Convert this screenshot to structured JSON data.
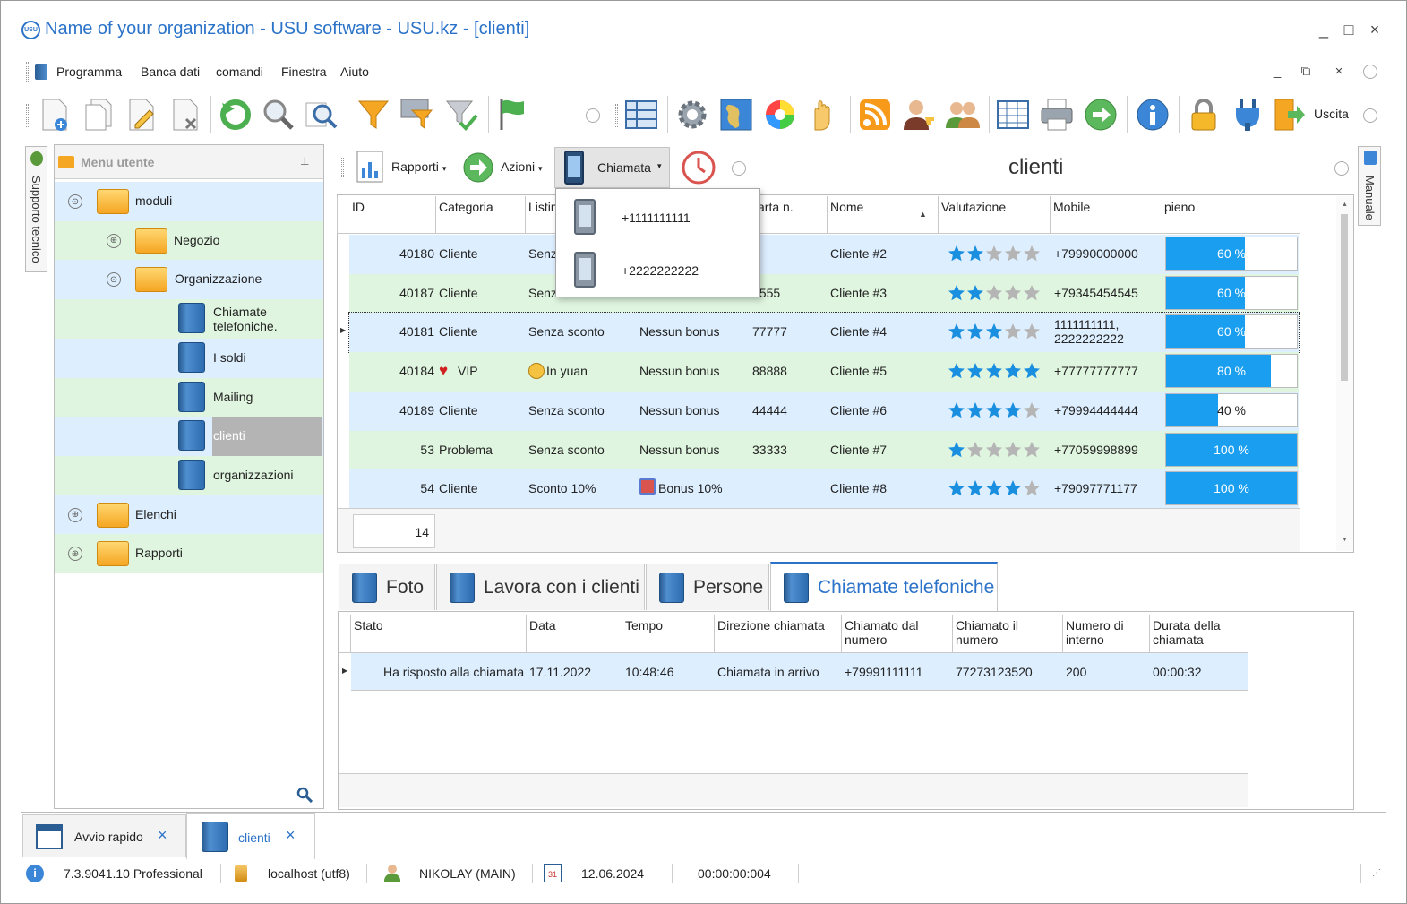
{
  "window": {
    "title": "Name of your organization - USU software - USU.kz - [clienti]",
    "logo_text": "USU",
    "controls": [
      "_",
      "□",
      "×"
    ]
  },
  "menu": {
    "items": [
      "Programma",
      "Banca dati",
      "comandi",
      "Finestra",
      "Aiuto"
    ],
    "mdi_controls": [
      "_",
      "⧉",
      "×"
    ]
  },
  "toolbar": {
    "exit_label": "Uscita"
  },
  "side_tabs": {
    "left": "Supporto tecnico",
    "right": "Manuale"
  },
  "user_menu": {
    "header": "Menu utente",
    "pin": "⊥",
    "items": [
      {
        "label": "moduli",
        "icon": "folder-icon",
        "expander": "⊙",
        "color": "#ddeeff"
      },
      {
        "label": "Negozio",
        "icon": "folder-icon",
        "expander": "⊕",
        "color": "#dff5df"
      },
      {
        "label": "Organizzazione",
        "icon": "folder-icon",
        "expander": "⊙",
        "color": "#ddeeff"
      },
      {
        "label": "Chiamate telefoniche.",
        "icon": "book-icon",
        "color": "#dff5df"
      },
      {
        "label": "I soldi",
        "icon": "book-icon",
        "color": "#ddeeff"
      },
      {
        "label": "Mailing",
        "icon": "book-icon",
        "color": "#dff5df"
      },
      {
        "label": "clienti",
        "icon": "book-icon",
        "color": "#ddeeff",
        "selected": true
      },
      {
        "label": "organizzazioni",
        "icon": "book-icon",
        "color": "#dff5df"
      },
      {
        "label": "Elenchi",
        "icon": "folder-icon",
        "expander": "⊕",
        "color": "#ddeeff"
      },
      {
        "label": "Rapporti",
        "icon": "folder-icon",
        "expander": "⊕",
        "color": "#dff5df"
      }
    ]
  },
  "module_toolbar": {
    "rapporti": "Rapporti",
    "azioni": "Azioni",
    "chiamata": "Chiamata",
    "title": "clienti"
  },
  "call_dropdown": {
    "items": [
      "+1111111111",
      "+2222222222"
    ]
  },
  "clients_grid": {
    "columns": [
      "ID",
      "Categoria",
      "Listin",
      "arta n.",
      "Nome",
      "Valutazione",
      "Mobile",
      "pieno"
    ],
    "rows": [
      {
        "id": "40180",
        "categoria": "Cliente",
        "listino": "Senz",
        "bonus": "",
        "carta": "",
        "nome": "Cliente #2",
        "stars": 2,
        "mobile": "+79990000000",
        "pieno_value": 60,
        "pieno_label": "60 %",
        "bg": "#ddeeff"
      },
      {
        "id": "40187",
        "categoria": "Cliente",
        "listino": "Senz",
        "bonus": "",
        "carta": "5555",
        "nome": "Cliente #3",
        "stars": 2,
        "mobile": "+79345454545",
        "pieno_value": 60,
        "pieno_label": "60 %",
        "bg": "#dff5df"
      },
      {
        "id": "40181",
        "categoria": "Cliente",
        "listino": "Senza sconto",
        "bonus": "Nessun bonus",
        "carta": "77777",
        "nome": "Cliente #4",
        "stars": 3,
        "mobile": "1111111111,\n2222222222",
        "pieno_value": 60,
        "pieno_label": "60 %",
        "bg": "#ddeeff",
        "current": true
      },
      {
        "id": "40184",
        "categoria": "VIP",
        "cat_icon": "heart-icon",
        "listino": "In yuan",
        "list_icon": "coin-icon",
        "bonus": "Nessun bonus",
        "carta": "88888",
        "nome": "Cliente #5",
        "stars": 5,
        "mobile": "+77777777777",
        "pieno_value": 80,
        "pieno_label": "80 %",
        "bg": "#dff5df"
      },
      {
        "id": "40189",
        "categoria": "Cliente",
        "listino": "Senza sconto",
        "bonus": "Nessun bonus",
        "carta": "44444",
        "nome": "Cliente #6",
        "stars": 4,
        "mobile": "+79994444444",
        "pieno_value": 40,
        "pieno_label": "40 %",
        "bg": "#ddeeff"
      },
      {
        "id": "53",
        "categoria": "Problema",
        "listino": "Senza sconto",
        "bonus": "Nessun bonus",
        "carta": "33333",
        "nome": "Cliente #7",
        "stars": 1,
        "mobile": "+77059998899",
        "pieno_value": 100,
        "pieno_label": "100 %",
        "bg": "#dff5df"
      },
      {
        "id": "54",
        "categoria": "Cliente",
        "listino": "Sconto 10%",
        "bonus": "Bonus 10%",
        "bonus_icon": "gift-icon",
        "carta": "",
        "nome": "Cliente #8",
        "stars": 4,
        "mobile": "+79097771177",
        "pieno_value": 100,
        "pieno_label": "100 %",
        "bg": "#ddeeff"
      }
    ],
    "count": "14"
  },
  "detail_tabs": [
    "Foto",
    "Lavora con i clienti",
    "Persone",
    "Chiamate telefoniche"
  ],
  "calls_grid": {
    "columns": [
      "Stato",
      "Data",
      "Tempo",
      "Direzione chiamata",
      "Chiamato dal numero",
      "Chiamato il numero",
      "Numero di interno",
      "Durata della chiamata"
    ],
    "rows": [
      {
        "stato": "Ha risposto alla chiamata",
        "data": "17.11.2022",
        "tempo": "10:48:46",
        "direzione": "Chiamata in arrivo",
        "dal": "+79991111111",
        "il": "77273123520",
        "interno": "200",
        "durata": "00:00:32"
      }
    ]
  },
  "window_tabs": [
    {
      "label": "Avvio rapido",
      "close": "×"
    },
    {
      "label": "clienti",
      "close": "×",
      "active": true
    }
  ],
  "status": {
    "version": "7.3.9041.10 Professional",
    "db": "localhost (utf8)",
    "user": "NIKOLAY (MAIN)",
    "calendar_day": "31",
    "date": "12.06.2024",
    "timer": "00:00:00:004"
  },
  "colors": {
    "accent": "#2b73c9",
    "row_blue": "#ddeeff",
    "row_green": "#dff5df",
    "bar": "#1a9ff0",
    "star": "#1a8fe0",
    "star_off": "#b5b5b5"
  }
}
